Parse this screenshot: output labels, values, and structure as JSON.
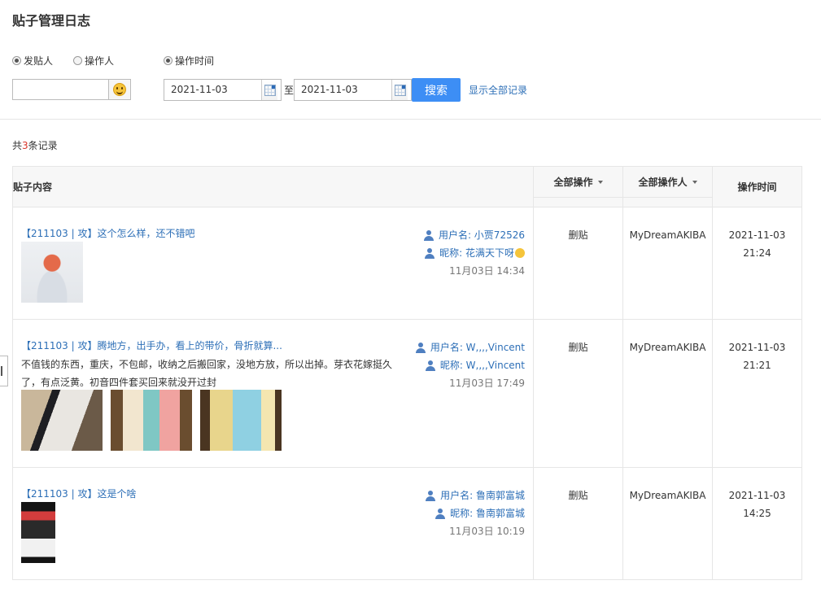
{
  "page": {
    "title": "贴子管理日志"
  },
  "filter": {
    "radio_poster": "发贴人",
    "radio_operator": "操作人",
    "radio_time": "操作时间",
    "name_value": "",
    "date_from": "2021-11-03",
    "date_to": "2021-11-03",
    "to_label": "至",
    "search_label": "搜索",
    "show_all_label": "显示全部记录"
  },
  "summary": {
    "prefix": "共",
    "count": "3",
    "suffix": "条记录"
  },
  "table": {
    "headers": {
      "content": "贴子内容",
      "action": "全部操作",
      "operator": "全部操作人",
      "time": "操作时间"
    },
    "rows": [
      {
        "title": "【211103 | 攻】这个怎么样，还不错吧",
        "body": "",
        "username": "用户名: 小贾72526",
        "nickname": "昵称: 花满天下呀",
        "post_time": "11月03日 14:34",
        "action": "删贴",
        "operator": "MyDreamAKIBA",
        "op_date": "2021-11-03",
        "op_time": "21:24"
      },
      {
        "title": "【211103 | 攻】腾地方，出手办，看上的带价，骨折就算...",
        "body": "不值钱的东西，重庆，不包邮，收纳之后搬回家，没地方放，所以出掉。芽衣花嫁挺久了，有点泛黄。初音四件套买回来就没开过封",
        "username": "用户名: W,,,,Vincent",
        "nickname": "昵称: W,,,,Vincent",
        "post_time": "11月03日 17:49",
        "action": "删贴",
        "operator": "MyDreamAKIBA",
        "op_date": "2021-11-03",
        "op_time": "21:21"
      },
      {
        "title": "【211103 | 攻】这是个啥",
        "body": "",
        "username": "用户名: 鲁南郭富城",
        "nickname": "昵称: 鲁南郭富城",
        "post_time": "11月03日 10:19",
        "action": "删贴",
        "operator": "MyDreamAKIBA",
        "op_date": "2021-11-03",
        "op_time": "14:25"
      }
    ]
  },
  "icons": {
    "emoji_button": "smile-emoji-icon",
    "calendar": "calendar-icon",
    "user": "user-icon",
    "filter_caret": "caret-down-icon"
  },
  "colors": {
    "accent": "#3d8ef5",
    "link": "#2d6fb7",
    "count": "#d9362b"
  }
}
